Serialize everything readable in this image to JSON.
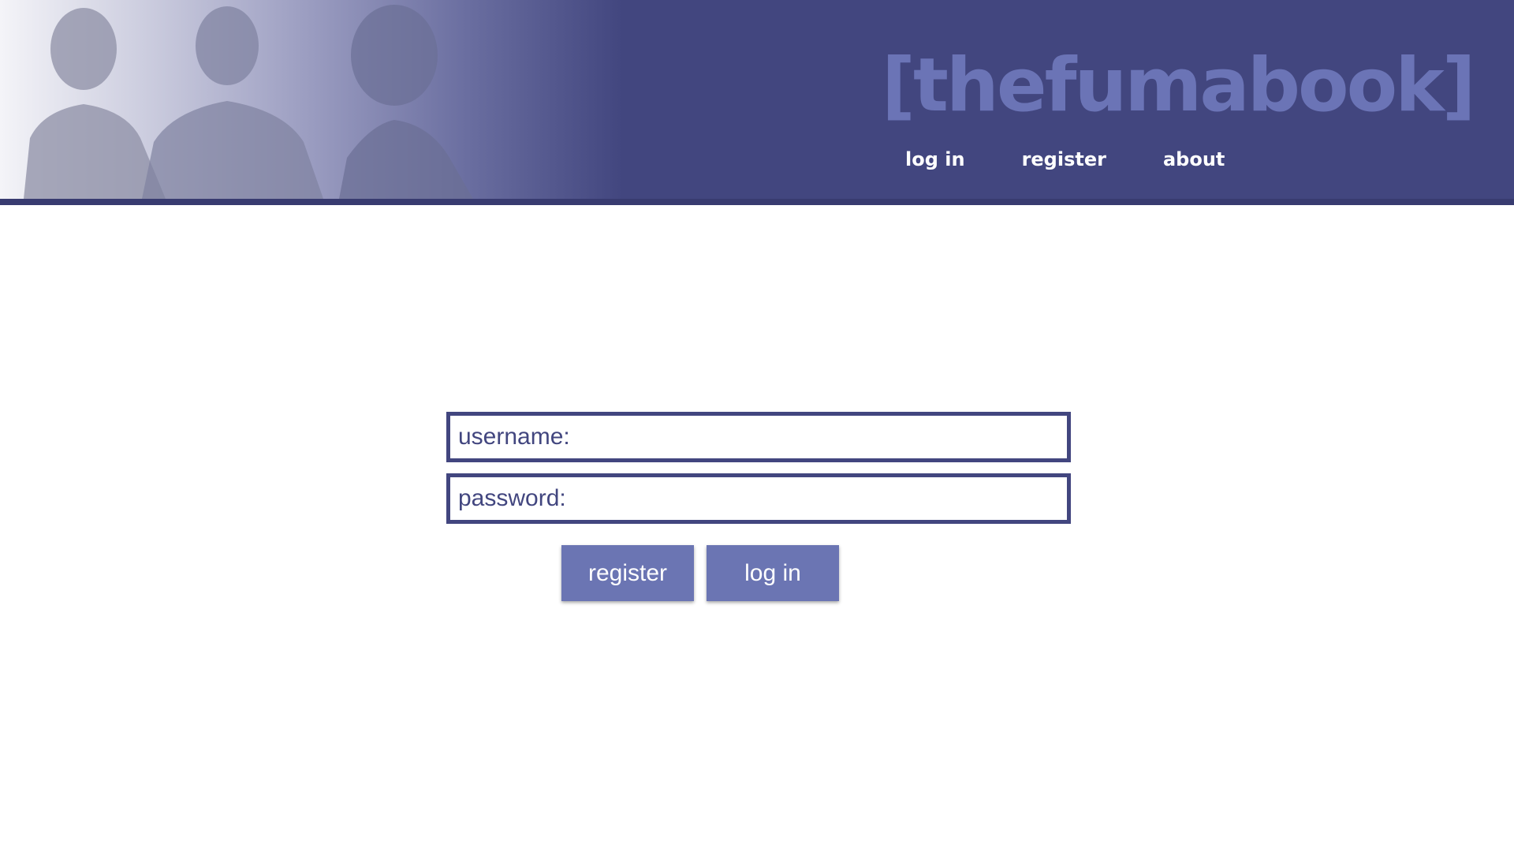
{
  "header": {
    "logo": "[thefumabook]",
    "nav": {
      "login": "log in",
      "register": "register",
      "about": "about"
    }
  },
  "form": {
    "username_placeholder": "username:",
    "password_placeholder": "password:",
    "register_label": "register",
    "login_label": "log in"
  },
  "colors": {
    "header_bg": "#42467f",
    "logo": "#6b74b6",
    "button_bg": "#6b75b3",
    "field_border": "#42467f"
  }
}
